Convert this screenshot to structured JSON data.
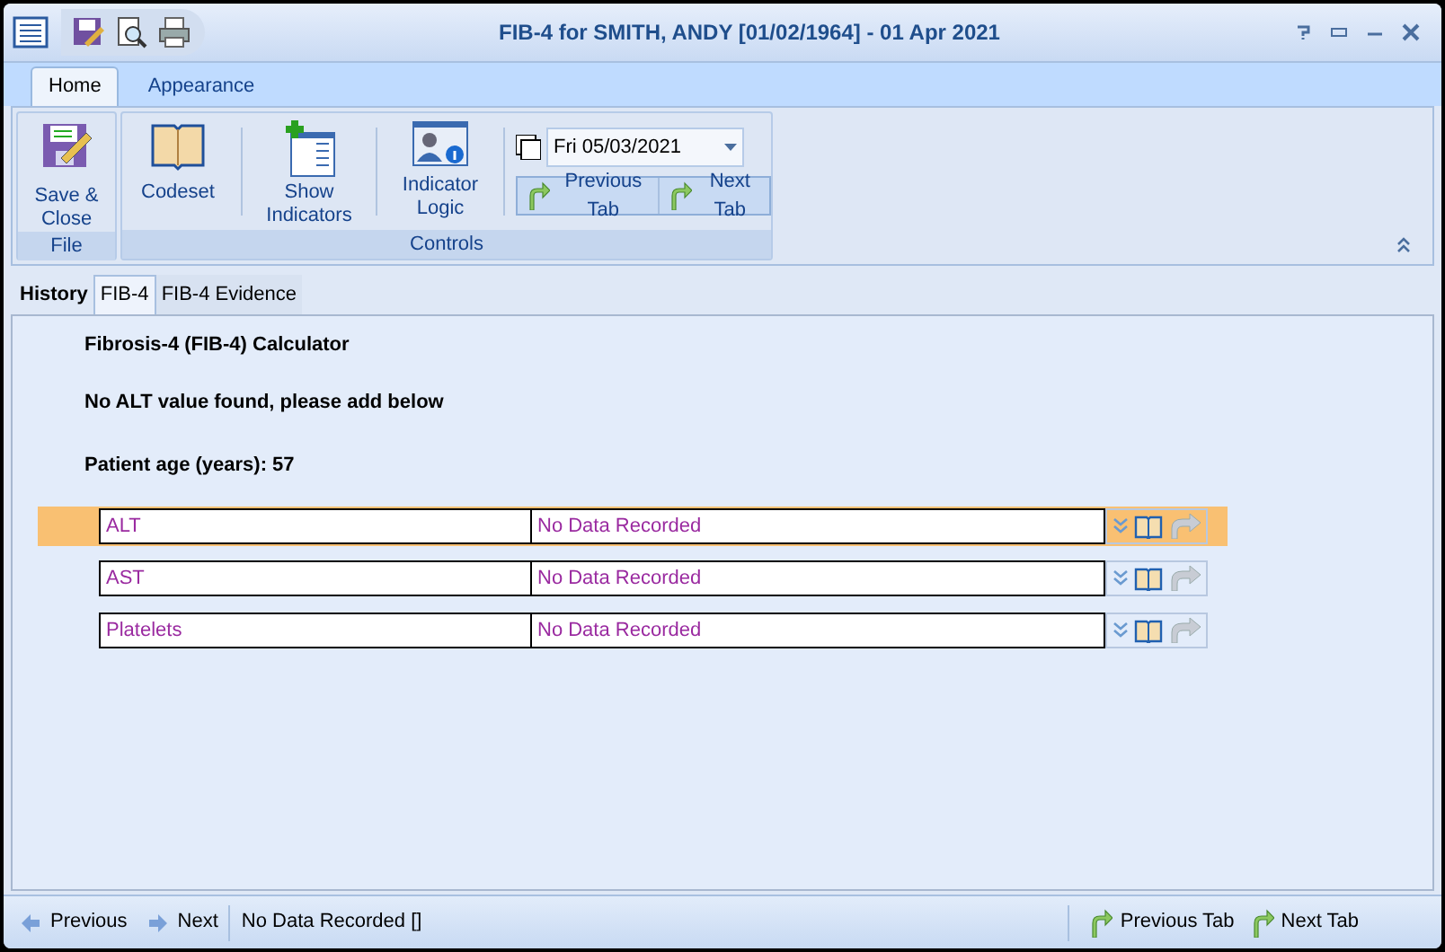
{
  "window": {
    "title": "FIB-4 for SMITH, ANDY [01/02/1964] - 01 Apr 2021"
  },
  "ribbon_tabs": [
    {
      "label": "Home",
      "selected": true
    },
    {
      "label": "Appearance",
      "selected": false
    }
  ],
  "ribbon": {
    "file_group": {
      "label": "File",
      "buttons": [
        "Save & Close"
      ]
    },
    "controls_group": {
      "label": "Controls",
      "buttons": [
        "Codeset",
        "Show Indicators",
        "Indicator Logic"
      ],
      "date": "Fri 05/03/2021",
      "previous_tab": "Previous Tab",
      "next_tab": "Next Tab"
    }
  },
  "doc_tabs": [
    {
      "label": "History",
      "selected": false
    },
    {
      "label": "FIB-4",
      "selected": true
    },
    {
      "label": "FIB-4 Evidence",
      "selected": false
    }
  ],
  "content": {
    "heading": "Fibrosis-4 (FIB-4) Calculator",
    "message": "No ALT value found, please add below",
    "age": "Patient age (years): 57"
  },
  "rows": [
    {
      "name": "ALT",
      "value": "No Data Recorded",
      "selected": true
    },
    {
      "name": "AST",
      "value": "No Data Recorded",
      "selected": false
    },
    {
      "name": "Platelets",
      "value": "No Data Recorded",
      "selected": false
    }
  ],
  "status_bar": {
    "previous": "Previous",
    "next": "Next",
    "info": "No Data Recorded []",
    "previous_tab": "Previous Tab",
    "next_tab": "Next Tab"
  }
}
